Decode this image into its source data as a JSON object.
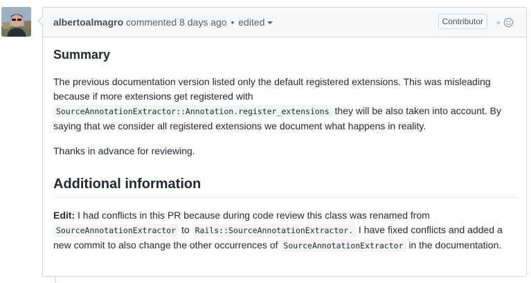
{
  "header": {
    "author": "albertoalmagro",
    "action": "commented",
    "time": "8 days ago",
    "separator": "•",
    "edited": "edited",
    "badge": "Contributor",
    "reaction_plus": "+"
  },
  "body": {
    "summary_heading": "Summary",
    "p1": {
      "t1": "The previous documentation version listed only the default registered extensions. This was misleading because if more extensions get registered with ",
      "code1": "SourceAnnotationExtractor::Annotation.register_extensions",
      "t2": " they will be also taken into account. By saying that we consider all registered extensions we document what happens in reality."
    },
    "p2": "Thanks in advance for reviewing.",
    "additional_heading": "Additional information",
    "p3": {
      "bold": "Edit:",
      "t1": " I had conflicts in this PR because during code review this class was renamed from ",
      "code1": "SourceAnnotationExtractor",
      "t2": " to ",
      "code2": "Rails::SourceAnnotationExtractor.",
      "t3": " I have fixed conflicts and added a new commit to also change the other occurrences of ",
      "code3": "SourceAnnotationExtractor",
      "t4": " in the documentation."
    }
  },
  "colors": {
    "border": "#d1d5da",
    "header_bg": "#f6f8fa",
    "text": "#24292e",
    "muted": "#586069"
  }
}
